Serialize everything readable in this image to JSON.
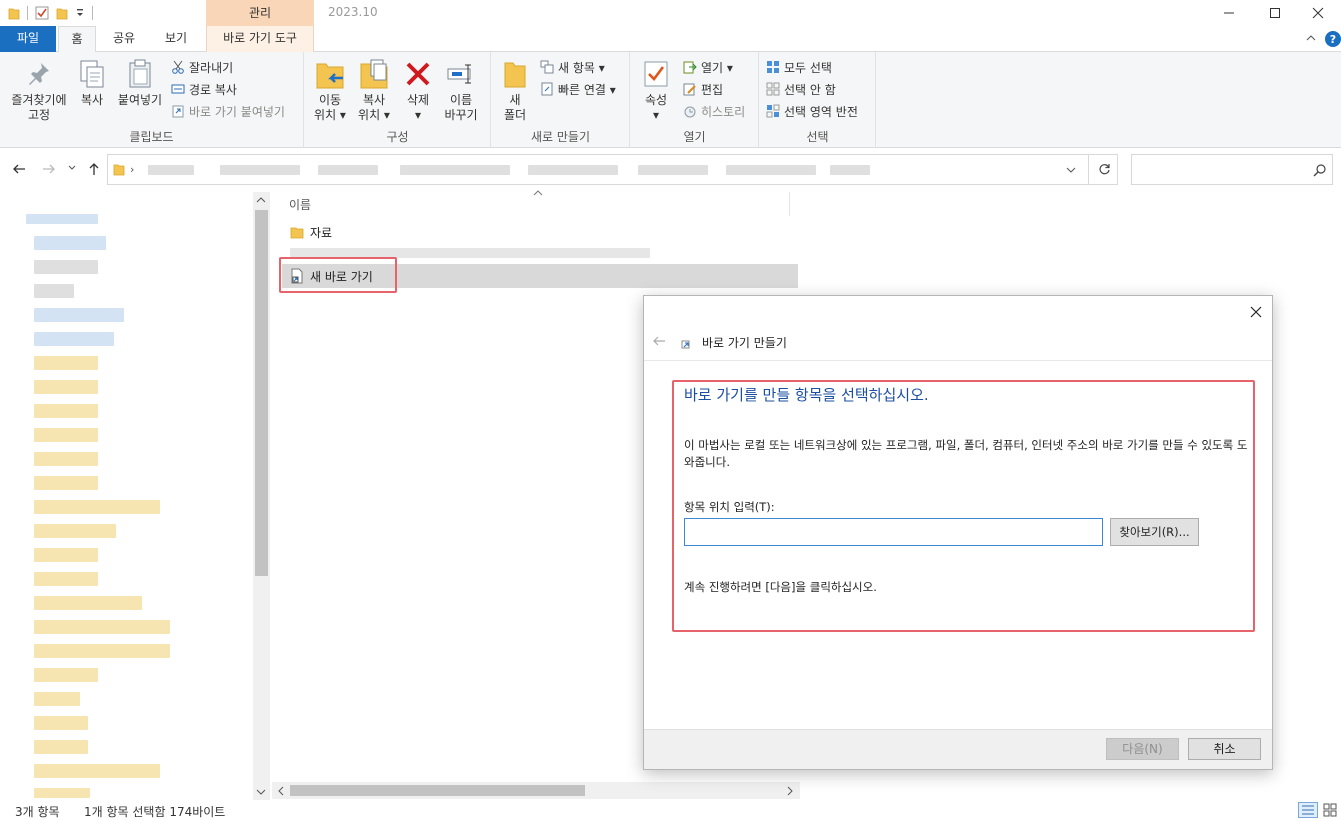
{
  "title_bar": {
    "context_tab_label": "관리",
    "window_title": "2023.10"
  },
  "tabs": {
    "file": "파일",
    "home": "홈",
    "share": "공유",
    "view": "보기",
    "shortcut_tools": "바로 가기 도구"
  },
  "ribbon": {
    "clipboard": {
      "pin_quick_access": [
        "즐겨찾기에",
        "고정"
      ],
      "copy": "복사",
      "paste": "붙여넣기",
      "cut": "잘라내기",
      "copy_path": "경로 복사",
      "paste_shortcut": "바로 가기 붙여넣기",
      "group_label": "클립보드"
    },
    "organize": {
      "move_to": [
        "이동",
        "위치 ▾"
      ],
      "copy_to": [
        "복사",
        "위치 ▾"
      ],
      "delete": [
        "삭제",
        "▾"
      ],
      "rename": [
        "이름",
        "바꾸기"
      ],
      "group_label": "구성"
    },
    "new": {
      "new_folder": [
        "새",
        "폴더"
      ],
      "new_item": "새 항목 ▾",
      "easy_access": "빠른 연결 ▾",
      "group_label": "새로 만들기"
    },
    "open": {
      "properties": [
        "속성",
        "▾"
      ],
      "open": "열기 ▾",
      "edit": "편집",
      "history": "히스토리",
      "group_label": "열기"
    },
    "select": {
      "select_all": "모두 선택",
      "select_none": "선택 안 함",
      "invert_selection": "선택 영역 반전",
      "group_label": "선택"
    }
  },
  "file_list": {
    "column_name": "이름",
    "items": [
      {
        "name": "자료",
        "type": "folder"
      },
      {
        "name": "새 바로 가기",
        "type": "shortcut",
        "selected": true
      }
    ]
  },
  "status_bar": {
    "item_count": "3개 항목",
    "selection": "1개 항목 선택함 174바이트"
  },
  "dialog": {
    "title": "바로 가기 만들기",
    "heading": "바로 가기를 만들 항목을 선택하십시오.",
    "description": "이 마법사는 로컬 또는 네트워크상에 있는 프로그램, 파일, 폴더, 컴퓨터, 인터넷 주소의 바로 가기를 만들 수 있도록 도와줍니다.",
    "location_label": "항목 위치 입력(T):",
    "location_value": "",
    "browse_button": "찾아보기(R)...",
    "continue_hint": "계속 진행하려면 [다음]을 클릭하십시오.",
    "next_button": "다음(N)",
    "cancel_button": "취소"
  },
  "colors": {
    "file_tab": "#1a6fc1",
    "context_tab": "#f9d6b7",
    "highlight_box": "#e6636b",
    "dialog_heading": "#1c4fa0",
    "selected_row": "#d9d9d9"
  }
}
